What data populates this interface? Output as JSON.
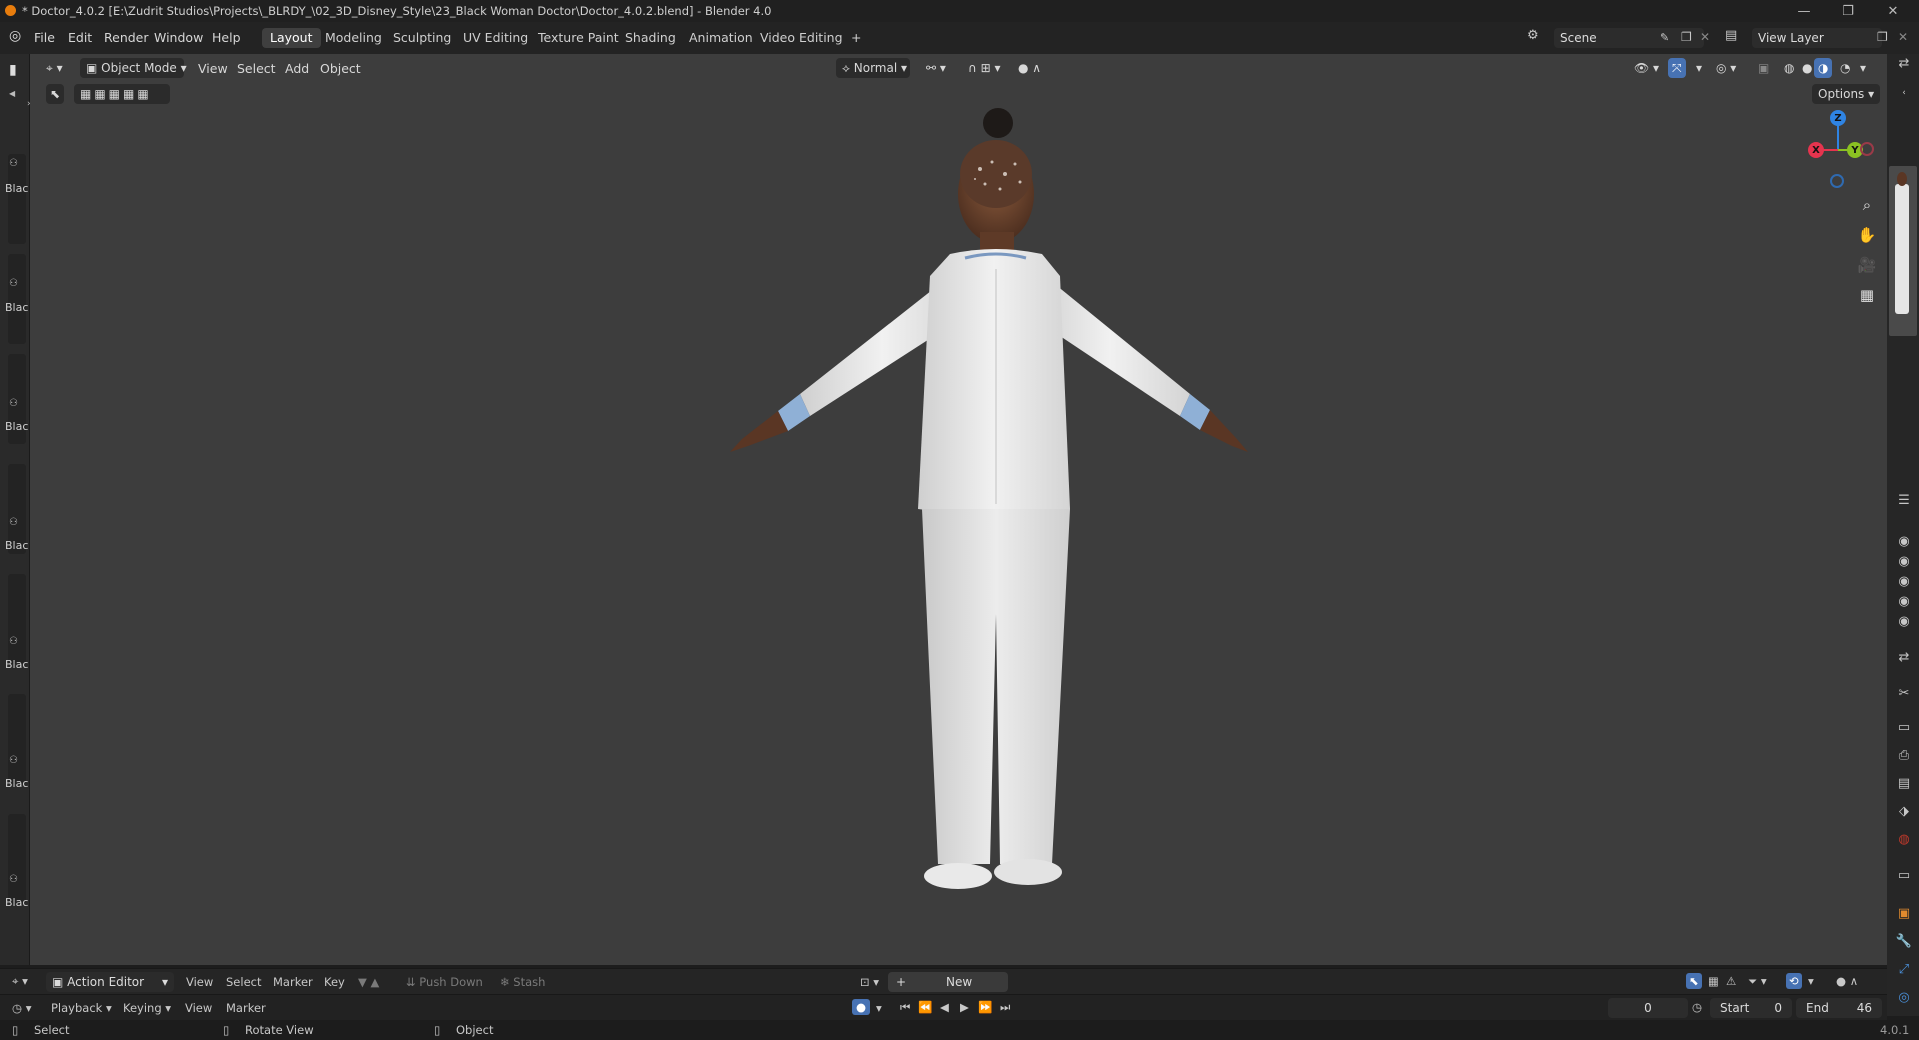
{
  "window": {
    "title": "* Doctor_4.0.2 [E:\\Zudrit Studios\\Projects\\_BLRDY_\\02_3D_Disney_Style\\23_Black Woman Doctor\\Doctor_4.0.2.blend] - Blender 4.0",
    "minimize": "—",
    "maximize": "❐",
    "close": "✕"
  },
  "menu": {
    "items": [
      "File",
      "Edit",
      "Render",
      "Window",
      "Help"
    ]
  },
  "workspaces": {
    "tabs": [
      "Layout",
      "Modeling",
      "Sculpting",
      "UV Editing",
      "Texture Paint",
      "Shading",
      "Animation",
      "Video Editing"
    ],
    "add": "+"
  },
  "scene": {
    "name": "Scene"
  },
  "view_layer": {
    "name": "View Layer"
  },
  "viewport_header": {
    "mode": "Object Mode",
    "menus": [
      "View",
      "Select",
      "Add",
      "Object"
    ],
    "orientation": "Normal",
    "options": "Options"
  },
  "gizmo": {
    "x": "X",
    "y": "Y",
    "z": "Z"
  },
  "left_strip": {
    "labels": [
      "Blac",
      "Blac",
      "Blac",
      "Blac",
      "Blac",
      "Blac",
      "Blac"
    ]
  },
  "action_editor": {
    "editor": "Action Editor",
    "menus": [
      "View",
      "Select",
      "Marker",
      "Key"
    ],
    "push_down": "Push Down",
    "stash": "Stash",
    "new": "New"
  },
  "timeline": {
    "menus": [
      "Playback",
      "Keying",
      "View",
      "Marker"
    ],
    "current_frame": "0",
    "start_label": "Start",
    "start": "0",
    "end_label": "End",
    "end": "46"
  },
  "status": {
    "select": "Select",
    "rotate": "Rotate View",
    "object": "Object",
    "version": "4.0.1"
  },
  "colors": {
    "accent": "#4772b3",
    "x_axis": "#e5344e",
    "y_axis": "#8bc122",
    "z_axis": "#2f84e3"
  }
}
